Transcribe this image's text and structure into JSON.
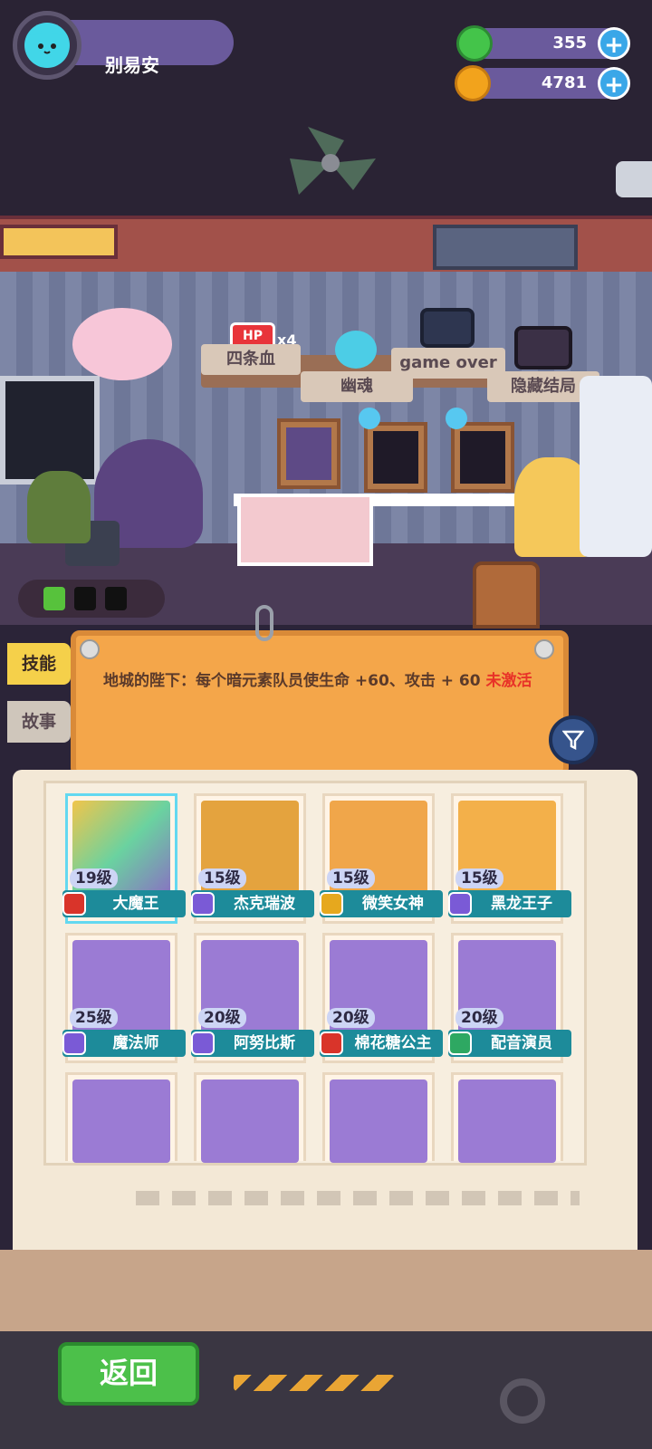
{
  "player": {
    "name": "别易安"
  },
  "resources": [
    {
      "icon": "green-gem-icon",
      "value": "355",
      "color": "#44c44a"
    },
    {
      "icon": "gold-planet-icon",
      "value": "4781",
      "color": "#f2a31c"
    }
  ],
  "room": {
    "hp_multiplier": "x4",
    "hp_badge": "HP",
    "shelf_labels": [
      "四条血",
      "幽魂",
      "game over",
      "隐藏结局"
    ]
  },
  "side_tabs": [
    "技能",
    "故事"
  ],
  "skill": {
    "text": "地城的陛下：每个暗元素队员使生命 +60、攻击 + 60",
    "status": "未激活"
  },
  "characters": [
    {
      "level": "19级",
      "name": "大魔王",
      "badge_color": "#d9342a",
      "img": "#8a6cc4"
    },
    {
      "level": "15级",
      "name": "杰克瑞波",
      "badge_color": "#7a5ad6",
      "img": "#e4a33e"
    },
    {
      "level": "15级",
      "name": "微笑女神",
      "badge_color": "#e6a81e",
      "img": "#f0a64a"
    },
    {
      "level": "15级",
      "name": "黑龙王子",
      "badge_color": "#7a5ad6",
      "img": "#f3b04a"
    },
    {
      "level": "25级",
      "name": "魔法师",
      "badge_color": "#7a5ad6",
      "img": "#9b7bd4"
    },
    {
      "level": "20级",
      "name": "阿努比斯",
      "badge_color": "#7a5ad6",
      "img": "#9b7bd4"
    },
    {
      "level": "20级",
      "name": "棉花糖公主",
      "badge_color": "#d9342a",
      "img": "#9b7bd4"
    },
    {
      "level": "20级",
      "name": "配音演员",
      "badge_color": "#2ea862",
      "img": "#9b7bd4"
    }
  ],
  "partial_characters": [
    {
      "img": "#9b7bd4"
    },
    {
      "img": "#9b7bd4"
    },
    {
      "img": "#9b7bd4"
    },
    {
      "img": "#9b7bd4"
    }
  ],
  "bottom": {
    "back_label": "返回"
  }
}
